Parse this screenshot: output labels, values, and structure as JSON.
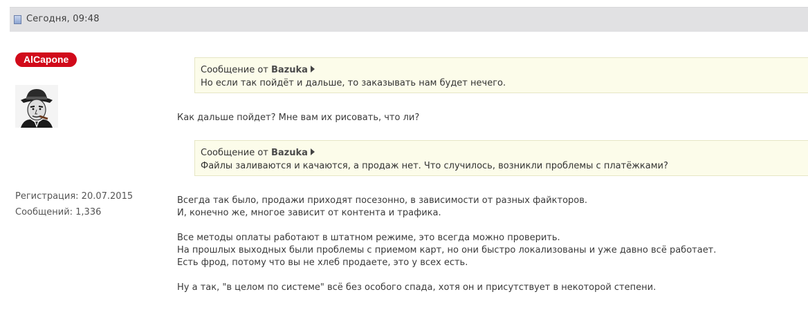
{
  "post": {
    "date": "Сегодня, 09:48"
  },
  "user": {
    "name": "AlCapone",
    "registration": "Регистрация: 20.07.2015",
    "messages": "Сообщений: 1,336"
  },
  "quotes": [
    {
      "prefix": "Сообщение от",
      "author": "Bazuka",
      "text": "Но если так пойдёт и дальше, то заказывать нам будет нечего."
    },
    {
      "prefix": "Сообщение от",
      "author": "Bazuka",
      "text": "Файлы заливаются и качаются, а продаж нет. Что случилось, возникли проблемы с платёжками?"
    }
  ],
  "body": {
    "reply1": "Как дальше пойдет? Мне вам их рисовать, что ли?",
    "para1": [
      "Всегда так было, продажи приходят посезонно, в зависимости от разных файкторов.",
      "И, конечно же, многое зависит от контента и трафика."
    ],
    "para2": [
      "Все методы оплаты работают в штатном режиме, это всегда можно проверить.",
      "На прошлых выходных были проблемы с приемом карт, но они быстро локализованы и уже давно всё работает.",
      "Есть фрод, потому что вы не хлеб продаете, это у всех есть."
    ],
    "para3": "Ну а так, \"в целом по системе\" всё без особого спада, хотя он и присутствует в некоторой степени."
  },
  "colors": {
    "badge": "#d10a1a",
    "header_bg": "#e1e1e3",
    "quote_bg": "#fcfcea"
  }
}
